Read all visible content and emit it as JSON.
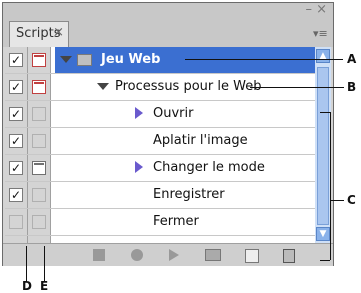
{
  "panel": {
    "tab_label": "Scripts",
    "close_glyph": "×",
    "minimize_glyph": "– ×",
    "menu_glyph": "▾≡"
  },
  "rows": [
    {
      "label": "Jeu Web",
      "checked": true,
      "dialog": "red",
      "selected": true
    },
    {
      "label": "Processus pour le Web",
      "checked": true,
      "dialog": "red"
    },
    {
      "label": "Ouvrir",
      "checked": true,
      "dialog": "empty",
      "expand": true
    },
    {
      "label": "Aplatir l'image",
      "checked": true,
      "dialog": "empty"
    },
    {
      "label": "Changer le mode",
      "checked": true,
      "dialog": "grey",
      "expand": true
    },
    {
      "label": "Enregistrer",
      "checked": true,
      "dialog": "empty"
    },
    {
      "label": "Fermer",
      "checked": false,
      "dialog": "empty"
    }
  ],
  "callouts": {
    "a": "A",
    "b": "B",
    "c": "C",
    "d": "D",
    "e": "E"
  },
  "toolbar": [
    "stop-icon",
    "record-icon",
    "play-icon",
    "folder-icon",
    "new-icon",
    "trash-icon"
  ],
  "colors": {
    "selection": "#3b6fd1",
    "dialog_red": "#c04040"
  }
}
